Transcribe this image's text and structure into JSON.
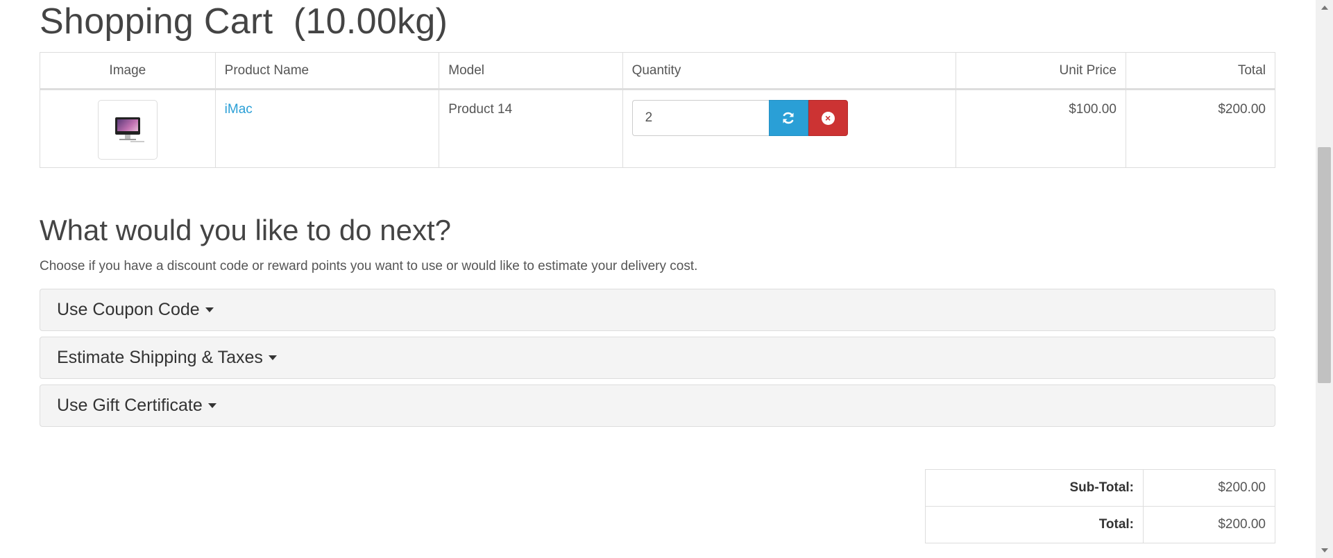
{
  "cart": {
    "title": "Shopping Cart  (10.00kg)",
    "columns": {
      "image": "Image",
      "name": "Product Name",
      "model": "Model",
      "quantity": "Quantity",
      "unit_price": "Unit Price",
      "total": "Total"
    },
    "items": [
      {
        "image_icon": "imac-thumbnail",
        "name": "iMac",
        "model": "Product 14",
        "quantity": "2",
        "unit_price": "$100.00",
        "total": "$200.00"
      }
    ],
    "update_icon": "refresh-icon",
    "remove_icon": "times-circle-icon",
    "remove_glyph": "×"
  },
  "next": {
    "title": "What would you like to do next?",
    "description": "Choose if you have a discount code or reward points you want to use or would like to estimate your delivery cost.",
    "panels": [
      {
        "label": "Use Coupon Code"
      },
      {
        "label": "Estimate Shipping & Taxes"
      },
      {
        "label": "Use Gift Certificate"
      }
    ]
  },
  "totals": [
    {
      "label": "Sub-Total:",
      "value": "$200.00"
    },
    {
      "label": "Total:",
      "value": "$200.00"
    }
  ],
  "colors": {
    "link": "#2a9fd6",
    "update_button": "#2a9fd6",
    "remove_button": "#cc3333",
    "panel_bg": "#f4f4f4"
  }
}
